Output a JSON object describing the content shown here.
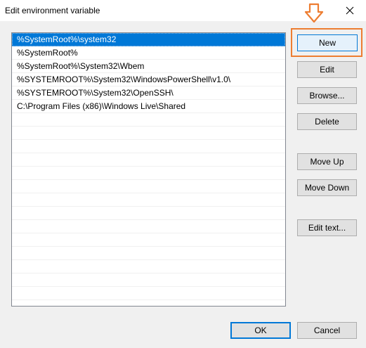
{
  "window": {
    "title": "Edit environment variable",
    "close_icon": "close-icon"
  },
  "list": {
    "items": [
      "%SystemRoot%\\system32",
      "%SystemRoot%",
      "%SystemRoot%\\System32\\Wbem",
      "%SYSTEMROOT%\\System32\\WindowsPowerShell\\v1.0\\",
      "%SYSTEMROOT%\\System32\\OpenSSH\\",
      "C:\\Program Files (x86)\\Windows Live\\Shared"
    ],
    "selected_index": 0
  },
  "buttons": {
    "new": "New",
    "edit": "Edit",
    "browse": "Browse...",
    "delete": "Delete",
    "move_up": "Move Up",
    "move_down": "Move Down",
    "edit_text": "Edit text...",
    "ok": "OK",
    "cancel": "Cancel"
  },
  "annotation": {
    "arrow_icon": "down-arrow-icon",
    "color": "#ed7d31"
  },
  "colors": {
    "selection": "#0078d7",
    "accent": "#0078d7"
  }
}
